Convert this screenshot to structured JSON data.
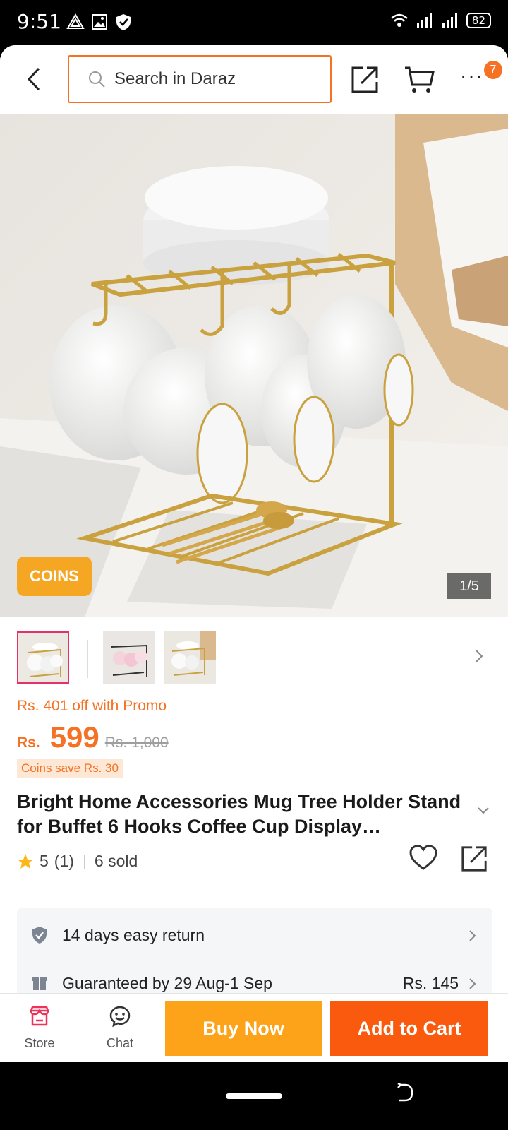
{
  "status_bar": {
    "time": "9:51",
    "battery": "82",
    "left_icons": [
      "drive-icon",
      "gallery-icon",
      "shield-icon"
    ],
    "right_icons": [
      "wifi-icon",
      "signal-icon",
      "signal-icon",
      "battery-icon"
    ]
  },
  "header": {
    "search_placeholder": "Search in Daraz",
    "cart_badge": "7",
    "accent_color": "#f57224"
  },
  "gallery": {
    "coins_tag": "COINS",
    "counter": "1/5",
    "thumbnail_count": 3,
    "active_thumbnail": 0
  },
  "price": {
    "promo": "Rs. 401 off with Promo",
    "currency": "Rs.",
    "value": "599",
    "original": "Rs. 1,000",
    "coins_save": "Coins save Rs. 30"
  },
  "product": {
    "title": "Bright Home Accessories Mug Tree Holder Stand for Buffet 6 Hooks Coffee Cup Display…",
    "rating": "5",
    "reviews": "(1)",
    "sold": "6 sold"
  },
  "services": [
    {
      "icon": "shield-check-icon",
      "text": "14 days easy return",
      "price": ""
    },
    {
      "icon": "delivery-icon",
      "text": "Guaranteed by 29 Aug-1 Sep",
      "price": "Rs. 145"
    }
  ],
  "bottom_bar": {
    "store_label": "Store",
    "chat_label": "Chat",
    "buy_now": "Buy Now",
    "add_to_cart": "Add to Cart",
    "buy_color": "#fca31a",
    "cart_color": "#fa5a0e"
  }
}
